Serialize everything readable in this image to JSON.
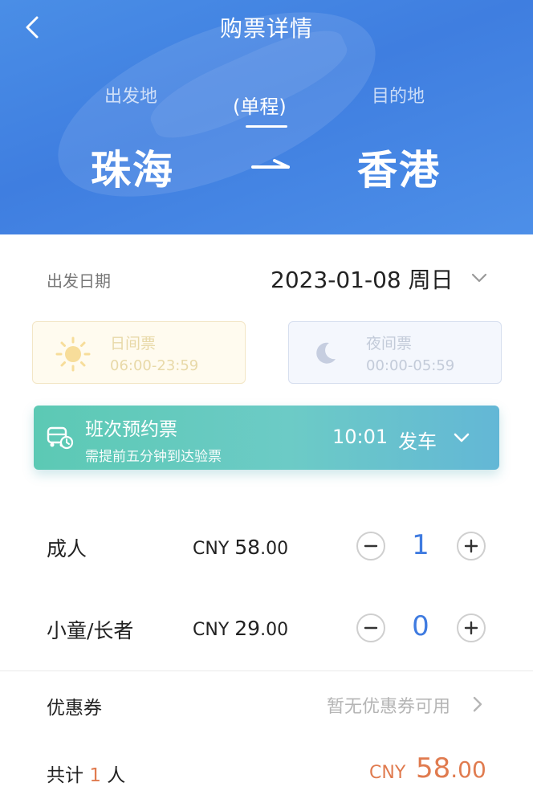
{
  "header": {
    "title": "购票详情",
    "from_label": "出发地",
    "to_label": "目的地",
    "trip_type": "(单程)",
    "from_city": "珠海",
    "to_city": "香港"
  },
  "date_row": {
    "label": "出发日期",
    "value": "2023-01-08 周日"
  },
  "ticket_periods": {
    "day": {
      "title": "日间票",
      "time": "06:00-23:59"
    },
    "night": {
      "title": "夜间票",
      "time": "00:00-05:59"
    }
  },
  "schedule_banner": {
    "title": "班次预约票",
    "subtitle": "需提前五分钟到达验票",
    "time": "10:01",
    "depart_label": "发车"
  },
  "passengers": [
    {
      "label": "成人",
      "currency": "CNY",
      "price_int": "58",
      "price_dec": ".00",
      "count": "1"
    },
    {
      "label": "小童/长者",
      "currency": "CNY",
      "price_int": "29",
      "price_dec": ".00",
      "count": "0"
    }
  ],
  "coupon": {
    "label": "优惠券",
    "value": "暂无优惠券可用"
  },
  "total": {
    "prefix": "共计",
    "count": "1",
    "suffix": "人",
    "currency": "CNY",
    "amount_int": "58",
    "amount_dec": ".00"
  },
  "colors": {
    "header_blue": "#4a8ee6",
    "count_blue": "#3f7be0",
    "banner_teal": "#5cc9b4",
    "price_orange": "#e07b4f"
  },
  "icons": {
    "back": "chevron-left-icon",
    "arrow": "arrow-right-icon",
    "date_dropdown": "chevron-down-icon",
    "day": "sun-icon",
    "night": "moon-icon",
    "banner": "bus-clock-icon",
    "minus": "minus-icon",
    "plus": "plus-icon",
    "coupon": "chevron-right-icon"
  }
}
